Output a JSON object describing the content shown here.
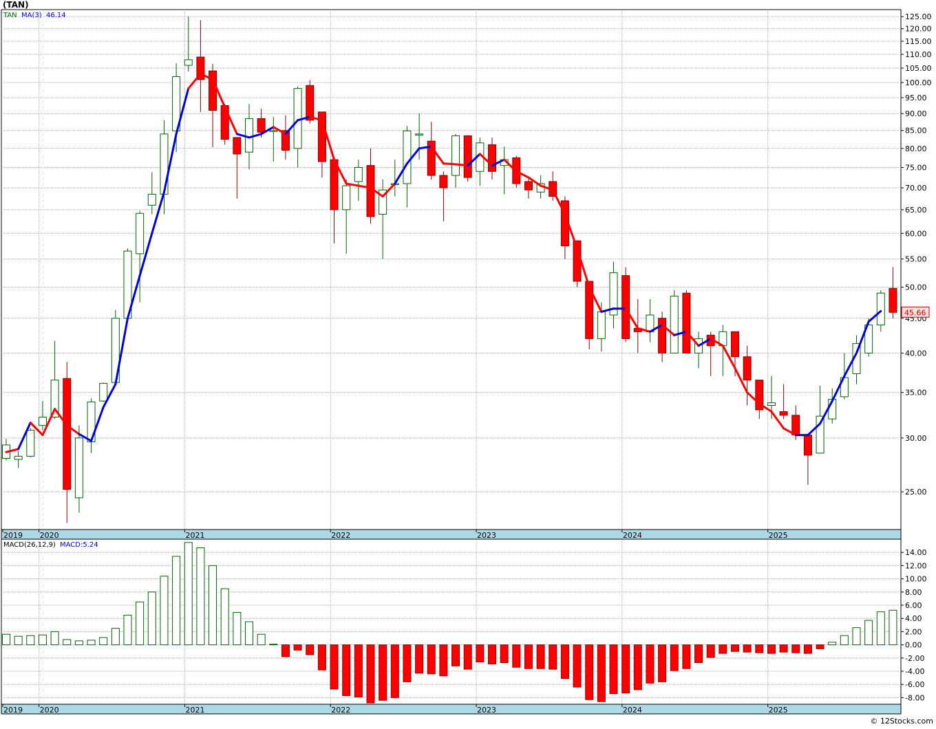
{
  "title": "(TAN)",
  "watermark": "© 12Stocks.com",
  "colors": {
    "up": "#006400",
    "down": "#ff0000",
    "ma_up": "#0000dd",
    "ma_down": "#ff0000",
    "grid": "#aaaaaa",
    "axis_bar": "#add8e6",
    "last_price_bg": "#ffdede"
  },
  "chart_data": [
    {
      "type": "candlestick",
      "title": "(TAN)",
      "legend": {
        "symbol": "TAN",
        "ma_label": "MA(3)",
        "ma_value": "46.14"
      },
      "last_price_label": "45.66",
      "y_scale": "log",
      "ylim": [
        22,
        128
      ],
      "y_ticks": [
        25,
        30,
        35,
        40,
        45,
        50,
        55,
        60,
        65,
        70,
        75,
        80,
        85,
        90,
        95,
        100,
        105,
        110,
        115,
        120,
        125
      ],
      "y_tick_labels": [
        "25.00",
        "30.00",
        "35.00",
        "40.00",
        "45.00",
        "50.00",
        "55.00",
        "60.00",
        "65.00",
        "70.00",
        "75.00",
        "80.00",
        "85.00",
        "90.00",
        "95.00",
        "100.00",
        "105.00",
        "110.00",
        "115.00",
        "120.00",
        "125.00"
      ],
      "x_labels": [
        {
          "label": "2019",
          "index": -0.5
        },
        {
          "label": "2020",
          "index": 2.7
        },
        {
          "label": "2021",
          "index": 14.7
        },
        {
          "label": "2022",
          "index": 26.7
        },
        {
          "label": "2023",
          "index": 38.7
        },
        {
          "label": "2024",
          "index": 50.7
        },
        {
          "label": "2025",
          "index": 62.7
        }
      ],
      "candles": [
        {
          "o": 28.0,
          "h": 29.9,
          "l": 27.8,
          "c": 29.3
        },
        {
          "o": 27.9,
          "h": 28.7,
          "l": 27.1,
          "c": 28.2
        },
        {
          "o": 28.2,
          "h": 31.0,
          "l": 28.1,
          "c": 30.8
        },
        {
          "o": 31.3,
          "h": 34.0,
          "l": 30.8,
          "c": 32.2
        },
        {
          "o": 32.2,
          "h": 41.7,
          "l": 32.0,
          "c": 36.5
        },
        {
          "o": 36.7,
          "h": 38.8,
          "l": 22.5,
          "c": 25.2
        },
        {
          "o": 24.5,
          "h": 31.3,
          "l": 23.3,
          "c": 30.0
        },
        {
          "o": 29.6,
          "h": 34.3,
          "l": 28.5,
          "c": 33.9
        },
        {
          "o": 34.0,
          "h": 36.2,
          "l": 33.9,
          "c": 36.1
        },
        {
          "o": 36.2,
          "h": 46.3,
          "l": 36.1,
          "c": 45.0
        },
        {
          "o": 45.0,
          "h": 57.0,
          "l": 45.0,
          "c": 56.5
        },
        {
          "o": 56.0,
          "h": 64.8,
          "l": 47.5,
          "c": 64.2
        },
        {
          "o": 66.0,
          "h": 73.8,
          "l": 64.0,
          "c": 68.5
        },
        {
          "o": 68.5,
          "h": 88.0,
          "l": 64.0,
          "c": 84.0
        },
        {
          "o": 84.9,
          "h": 106.7,
          "l": 79.0,
          "c": 102.0
        },
        {
          "o": 106.0,
          "h": 125.0,
          "l": 103.8,
          "c": 108.0
        },
        {
          "o": 109.0,
          "h": 123.5,
          "l": 90.5,
          "c": 101.0
        },
        {
          "o": 104.0,
          "h": 106.5,
          "l": 80.3,
          "c": 91.0
        },
        {
          "o": 92.5,
          "h": 93.0,
          "l": 81.0,
          "c": 82.5
        },
        {
          "o": 83.0,
          "h": 83.0,
          "l": 67.5,
          "c": 78.5
        },
        {
          "o": 79.0,
          "h": 93.0,
          "l": 74.5,
          "c": 88.5
        },
        {
          "o": 88.5,
          "h": 91.5,
          "l": 83.0,
          "c": 84.5
        },
        {
          "o": 85.0,
          "h": 89.0,
          "l": 76.5,
          "c": 85.0
        },
        {
          "o": 85.0,
          "h": 89.5,
          "l": 77.0,
          "c": 79.5
        },
        {
          "o": 80.0,
          "h": 98.7,
          "l": 75.0,
          "c": 98.0
        },
        {
          "o": 99.0,
          "h": 100.8,
          "l": 87.0,
          "c": 88.0
        },
        {
          "o": 90.5,
          "h": 90.5,
          "l": 72.5,
          "c": 76.5
        },
        {
          "o": 77.0,
          "h": 77.0,
          "l": 58.0,
          "c": 65.0
        },
        {
          "o": 65.0,
          "h": 72.0,
          "l": 56.0,
          "c": 70.5
        },
        {
          "o": 71.5,
          "h": 77.0,
          "l": 67.0,
          "c": 75.0
        },
        {
          "o": 75.5,
          "h": 80.0,
          "l": 62.0,
          "c": 63.5
        },
        {
          "o": 64.0,
          "h": 72.0,
          "l": 55.0,
          "c": 69.5
        },
        {
          "o": 71.0,
          "h": 77.0,
          "l": 68.0,
          "c": 71.0
        },
        {
          "o": 71.0,
          "h": 86.3,
          "l": 65.5,
          "c": 84.9
        },
        {
          "o": 84.0,
          "h": 90.0,
          "l": 77.0,
          "c": 84.0
        },
        {
          "o": 82.0,
          "h": 87.5,
          "l": 72.0,
          "c": 73.0
        },
        {
          "o": 73.0,
          "h": 74.0,
          "l": 62.5,
          "c": 70.0
        },
        {
          "o": 73.0,
          "h": 84.0,
          "l": 70.0,
          "c": 83.5
        },
        {
          "o": 83.5,
          "h": 83.5,
          "l": 71.5,
          "c": 72.5
        },
        {
          "o": 74.0,
          "h": 83.0,
          "l": 70.5,
          "c": 81.5
        },
        {
          "o": 81.0,
          "h": 83.0,
          "l": 72.0,
          "c": 74.0
        },
        {
          "o": 75.5,
          "h": 80.5,
          "l": 68.5,
          "c": 77.0
        },
        {
          "o": 77.5,
          "h": 78.0,
          "l": 70.0,
          "c": 71.0
        },
        {
          "o": 71.5,
          "h": 72.5,
          "l": 67.5,
          "c": 69.5
        },
        {
          "o": 69.0,
          "h": 73.0,
          "l": 67.5,
          "c": 71.0
        },
        {
          "o": 71.5,
          "h": 74.0,
          "l": 67.0,
          "c": 68.0
        },
        {
          "o": 67.0,
          "h": 68.0,
          "l": 55.0,
          "c": 57.5
        },
        {
          "o": 58.5,
          "h": 58.5,
          "l": 50.0,
          "c": 51.0
        },
        {
          "o": 51.0,
          "h": 51.0,
          "l": 40.5,
          "c": 42.0
        },
        {
          "o": 42.0,
          "h": 47.5,
          "l": 40.2,
          "c": 46.0
        },
        {
          "o": 45.5,
          "h": 54.5,
          "l": 43.5,
          "c": 52.5
        },
        {
          "o": 52.0,
          "h": 53.5,
          "l": 41.5,
          "c": 42.0
        },
        {
          "o": 43.5,
          "h": 48.0,
          "l": 40.0,
          "c": 43.0
        },
        {
          "o": 43.0,
          "h": 48.0,
          "l": 41.5,
          "c": 45.5
        },
        {
          "o": 45.0,
          "h": 46.0,
          "l": 38.8,
          "c": 40.0
        },
        {
          "o": 40.0,
          "h": 49.5,
          "l": 40.0,
          "c": 48.5
        },
        {
          "o": 49.0,
          "h": 49.5,
          "l": 40.0,
          "c": 40.0
        },
        {
          "o": 40.0,
          "h": 43.0,
          "l": 38.0,
          "c": 42.0
        },
        {
          "o": 42.5,
          "h": 43.0,
          "l": 37.0,
          "c": 41.0
        },
        {
          "o": 41.0,
          "h": 44.0,
          "l": 37.0,
          "c": 43.0
        },
        {
          "o": 43.0,
          "h": 43.0,
          "l": 37.0,
          "c": 39.5
        },
        {
          "o": 39.5,
          "h": 41.0,
          "l": 33.5,
          "c": 36.5
        },
        {
          "o": 36.5,
          "h": 36.5,
          "l": 32.0,
          "c": 33.0
        },
        {
          "o": 33.5,
          "h": 37.0,
          "l": 32.0,
          "c": 33.8
        },
        {
          "o": 32.8,
          "h": 36.0,
          "l": 32.0,
          "c": 32.4
        },
        {
          "o": 32.4,
          "h": 33.5,
          "l": 29.8,
          "c": 30.3
        },
        {
          "o": 30.3,
          "h": 30.3,
          "l": 25.6,
          "c": 28.3
        },
        {
          "o": 28.5,
          "h": 35.8,
          "l": 28.5,
          "c": 32.3
        },
        {
          "o": 32.0,
          "h": 35.5,
          "l": 31.5,
          "c": 34.2
        },
        {
          "o": 34.5,
          "h": 40.0,
          "l": 34.2,
          "c": 36.8
        },
        {
          "o": 37.3,
          "h": 42.5,
          "l": 36.0,
          "c": 41.3
        },
        {
          "o": 40.0,
          "h": 45.0,
          "l": 39.5,
          "c": 44.0
        },
        {
          "o": 44.0,
          "h": 49.5,
          "l": 43.0,
          "c": 49.0
        },
        {
          "o": 49.8,
          "h": 53.5,
          "l": 45.0,
          "c": 45.9
        }
      ],
      "ma": [
        28.6,
        28.9,
        31.6,
        30.3,
        33.1,
        31.3,
        30.4,
        29.7,
        33.3,
        36.0,
        45.0,
        52.0,
        60.0,
        69.0,
        84.0,
        98.0,
        103.0,
        101.0,
        92.0,
        84.0,
        83.0,
        84.0,
        86.0,
        84.0,
        88.0,
        89.0,
        88.0,
        77.0,
        71.0,
        70.5,
        70.0,
        68.0,
        71.0,
        76.0,
        80.0,
        80.5,
        76.0,
        75.8,
        75.5,
        78.5,
        75.5,
        77.0,
        74.0,
        72.5,
        70.5,
        69.5,
        64.0,
        57.0,
        50.0,
        46.0,
        46.5,
        46.5,
        43.5,
        43.0,
        44.0,
        42.5,
        43.0,
        41.0,
        42.0,
        41.0,
        38.0,
        35.0,
        33.7,
        32.8,
        31.0,
        30.3,
        30.3,
        31.5,
        34.0,
        37.0,
        40.0,
        44.5,
        46.1
      ],
      "ma_colors": [
        "r",
        "r",
        "b",
        "r",
        "r",
        "r",
        "r",
        "b",
        "b",
        "b",
        "b",
        "b",
        "b",
        "b",
        "b",
        "b",
        "r",
        "r",
        "r",
        "r",
        "b",
        "b",
        "b",
        "r",
        "b",
        "b",
        "r",
        "r",
        "r",
        "r",
        "r",
        "r",
        "r",
        "b",
        "b",
        "b",
        "r",
        "r",
        "r",
        "b",
        "r",
        "b",
        "r",
        "r",
        "r",
        "r",
        "r",
        "r",
        "r",
        "r",
        "b",
        "b",
        "r",
        "r",
        "b",
        "r",
        "b",
        "r",
        "b",
        "r",
        "r",
        "r",
        "r",
        "r",
        "r",
        "r",
        "b",
        "b",
        "b",
        "b",
        "b",
        "b",
        "b"
      ]
    },
    {
      "type": "bar",
      "title": "MACD(26,12,9)",
      "legend": {
        "label": "MACD(26,12,9)",
        "value_label": "MACD:5.24"
      },
      "ylim": [
        -9,
        16
      ],
      "y_ticks": [
        -8,
        -6,
        -4,
        -2,
        0,
        2,
        4,
        6,
        8,
        10,
        12,
        14
      ],
      "y_tick_labels": [
        "-8.00",
        "-6.00",
        "-4.00",
        "-2.00",
        "0.00",
        "2.00",
        "4.00",
        "6.00",
        "8.00",
        "10.00",
        "12.00",
        "14.00"
      ],
      "values": [
        1.6,
        1.3,
        1.4,
        1.5,
        2.0,
        0.8,
        0.6,
        0.7,
        1.1,
        2.5,
        4.5,
        6.5,
        8.0,
        10.4,
        13.4,
        15.5,
        14.7,
        12.0,
        8.5,
        4.9,
        3.5,
        1.6,
        0.1,
        -1.8,
        -0.8,
        -1.5,
        -3.8,
        -6.7,
        -7.7,
        -7.9,
        -8.8,
        -8.4,
        -8.0,
        -5.6,
        -4.3,
        -4.4,
        -4.7,
        -3.2,
        -3.7,
        -2.6,
        -2.9,
        -2.7,
        -3.4,
        -3.6,
        -3.6,
        -3.7,
        -5.1,
        -6.4,
        -8.3,
        -8.6,
        -7.4,
        -7.3,
        -6.8,
        -5.8,
        -5.6,
        -3.9,
        -3.6,
        -2.7,
        -1.9,
        -1.3,
        -1.0,
        -1.1,
        -1.2,
        -1.3,
        -1.1,
        -1.2,
        -1.3,
        -0.6,
        0.4,
        1.4,
        2.6,
        3.7,
        5.0,
        5.24
      ]
    }
  ]
}
